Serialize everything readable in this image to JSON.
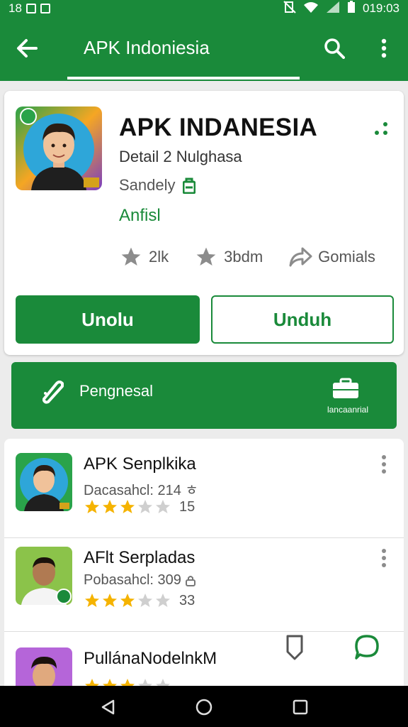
{
  "status_bar": {
    "left_text": "18",
    "time": "019:03"
  },
  "app_bar": {
    "title": "APK Indoniesia"
  },
  "detail": {
    "app_name": "APK INDANESIA",
    "subtitle": "Detail 2 Nulghasa",
    "developer": "Sandely",
    "category": "Anfisl",
    "stats": [
      {
        "icon": "star-icon",
        "label": "2lk"
      },
      {
        "icon": "star-icon",
        "label": "3bdm"
      },
      {
        "icon": "share-icon",
        "label": "Gomials"
      }
    ],
    "primary_button": "Unolu",
    "secondary_button": "Unduh"
  },
  "banner": {
    "label": "Pengnesal",
    "right_label": "lancaanrial"
  },
  "list": [
    {
      "title": "APK Senplkika",
      "subtitle": "Dacasahcl: 214 ㅎ",
      "rating_value": 3,
      "rating_max": 5,
      "rating_label": "15"
    },
    {
      "title": "AFlt Serpladas",
      "subtitle": "Pobasahcl: 309",
      "rating_value": 3,
      "rating_max": 5,
      "rating_label": "33"
    },
    {
      "title": "PullánaNodelnkM",
      "subtitle": "",
      "rating_value": 3,
      "rating_max": 5,
      "rating_label": ""
    }
  ],
  "colors": {
    "brand_green": "#1a8a3a",
    "star": "#f5b300",
    "star_empty": "#cfcfcf"
  }
}
